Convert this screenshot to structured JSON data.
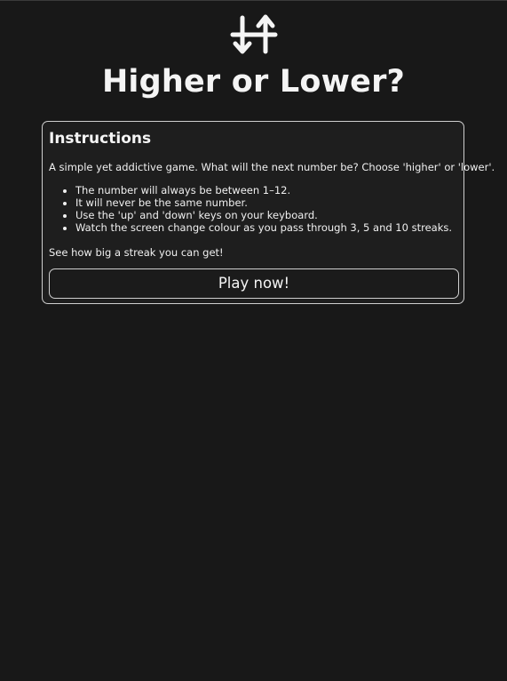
{
  "header": {
    "logo_icon": "up-down-arrows-icon",
    "title": "Higher or Lower?"
  },
  "instructions": {
    "heading": "Instructions",
    "intro": "A simple yet addictive game. What will the next number be? Choose 'higher' or 'lower'.",
    "rules": [
      "The number will always be between 1–12.",
      "It will never be the same number.",
      "Use the 'up' and 'down' keys on your keyboard.",
      "Watch the screen change colour as you pass through 3, 5 and 10 streaks."
    ],
    "outro": "See how big a streak you can get!",
    "play_label": "Play now!"
  },
  "colors": {
    "background": "#181818",
    "card_background": "#1e1e1e",
    "border": "#cfcfcf",
    "text": "#f4f4f4"
  }
}
